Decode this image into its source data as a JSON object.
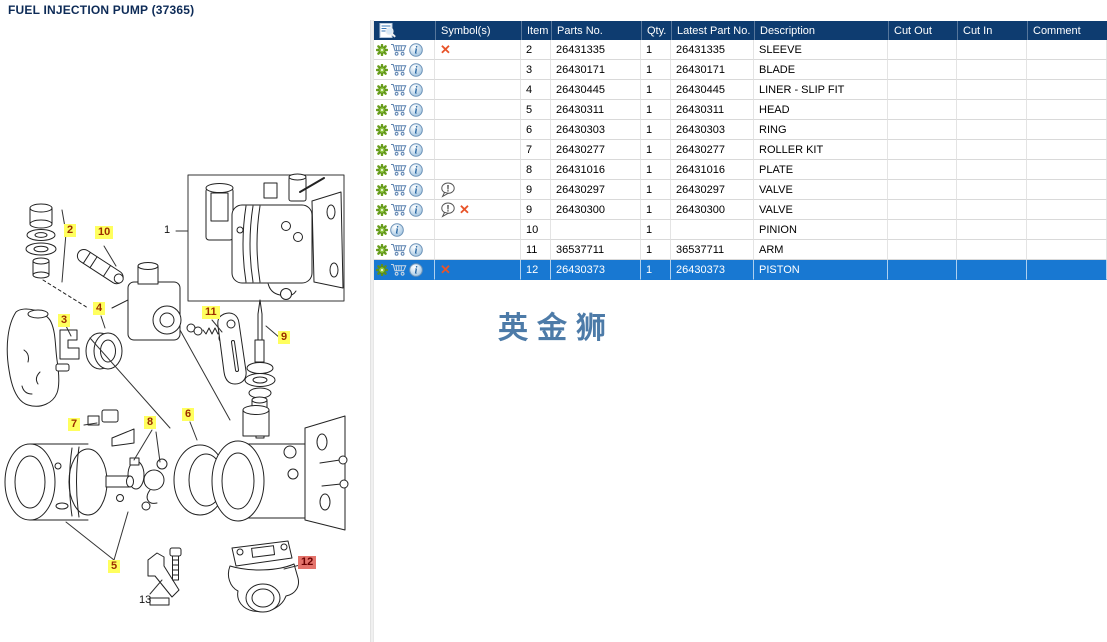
{
  "page": {
    "title": "FUEL INJECTION PUMP (37365)"
  },
  "watermark": {
    "text": "英金狮"
  },
  "toolbar": {
    "buttons": [
      {
        "name": "zoom-in-button",
        "icon": "plus-icon"
      },
      {
        "name": "zoom-out-button",
        "icon": "minus-icon"
      },
      {
        "name": "tile-view-button",
        "icon": "grid-icon"
      },
      {
        "name": "fit-view-button",
        "icon": "square-icon"
      },
      {
        "name": "toggle-panel-button",
        "icon": "panel-arrow-icon"
      }
    ]
  },
  "diagram": {
    "callouts": [
      {
        "label": "1",
        "style": "plain"
      },
      {
        "label": "2",
        "style": "yellow"
      },
      {
        "label": "3",
        "style": "yellow"
      },
      {
        "label": "4",
        "style": "yellow"
      },
      {
        "label": "5",
        "style": "yellow"
      },
      {
        "label": "6",
        "style": "yellow"
      },
      {
        "label": "7",
        "style": "yellow"
      },
      {
        "label": "8",
        "style": "yellow"
      },
      {
        "label": "9",
        "style": "yellow"
      },
      {
        "label": "10",
        "style": "yellow"
      },
      {
        "label": "11",
        "style": "yellow"
      },
      {
        "label": "12",
        "style": "red"
      },
      {
        "label": "13",
        "style": "plain"
      }
    ]
  },
  "table": {
    "columns": [
      "",
      "Symbol(s)",
      "Item",
      "Parts No.",
      "Qty.",
      "Latest Part No.",
      "Description",
      "Cut Out",
      "Cut In",
      "Comment"
    ],
    "rows": [
      {
        "symbols": [
          "x"
        ],
        "item": "2",
        "parts_no": "26431335",
        "qty": "1",
        "latest_part_no": "26431335",
        "description": "SLEEVE",
        "cut_out": "",
        "cut_in": "",
        "comment": "",
        "cart": true,
        "selected": false
      },
      {
        "symbols": [],
        "item": "3",
        "parts_no": "26430171",
        "qty": "1",
        "latest_part_no": "26430171",
        "description": "BLADE",
        "cut_out": "",
        "cut_in": "",
        "comment": "",
        "cart": true,
        "selected": false
      },
      {
        "symbols": [],
        "item": "4",
        "parts_no": "26430445",
        "qty": "1",
        "latest_part_no": "26430445",
        "description": "LINER - SLIP FIT",
        "cut_out": "",
        "cut_in": "",
        "comment": "",
        "cart": true,
        "selected": false
      },
      {
        "symbols": [],
        "item": "5",
        "parts_no": "26430311",
        "qty": "1",
        "latest_part_no": "26430311",
        "description": "HEAD",
        "cut_out": "",
        "cut_in": "",
        "comment": "",
        "cart": true,
        "selected": false
      },
      {
        "symbols": [],
        "item": "6",
        "parts_no": "26430303",
        "qty": "1",
        "latest_part_no": "26430303",
        "description": "RING",
        "cut_out": "",
        "cut_in": "",
        "comment": "",
        "cart": true,
        "selected": false
      },
      {
        "symbols": [],
        "item": "7",
        "parts_no": "26430277",
        "qty": "1",
        "latest_part_no": "26430277",
        "description": "ROLLER KIT",
        "cut_out": "",
        "cut_in": "",
        "comment": "",
        "cart": true,
        "selected": false
      },
      {
        "symbols": [],
        "item": "8",
        "parts_no": "26431016",
        "qty": "1",
        "latest_part_no": "26431016",
        "description": "PLATE",
        "cut_out": "",
        "cut_in": "",
        "comment": "",
        "cart": true,
        "selected": false
      },
      {
        "symbols": [
          "balloon"
        ],
        "item": "9",
        "parts_no": "26430297",
        "qty": "1",
        "latest_part_no": "26430297",
        "description": "VALVE",
        "cut_out": "",
        "cut_in": "",
        "comment": "",
        "cart": true,
        "selected": false
      },
      {
        "symbols": [
          "balloon",
          "x"
        ],
        "item": "9",
        "parts_no": "26430300",
        "qty": "1",
        "latest_part_no": "26430300",
        "description": "VALVE",
        "cut_out": "",
        "cut_in": "",
        "comment": "",
        "cart": true,
        "selected": false
      },
      {
        "symbols": [],
        "item": "10",
        "parts_no": "",
        "qty": "1",
        "latest_part_no": "",
        "description": "PINION",
        "cut_out": "",
        "cut_in": "",
        "comment": "",
        "cart": false,
        "selected": false
      },
      {
        "symbols": [],
        "item": "11",
        "parts_no": "36537711",
        "qty": "1",
        "latest_part_no": "36537711",
        "description": "ARM",
        "cut_out": "",
        "cut_in": "",
        "comment": "",
        "cart": true,
        "selected": false
      },
      {
        "symbols": [
          "x"
        ],
        "item": "12",
        "parts_no": "26430373",
        "qty": "1",
        "latest_part_no": "26430373",
        "description": "PISTON",
        "cut_out": "",
        "cut_in": "",
        "comment": "",
        "cart": true,
        "selected": true
      }
    ]
  },
  "colors": {
    "title_text": "#0d2b57",
    "header_bg": "#0e3c70",
    "selected_row_bg": "#1878d2",
    "callout_yellow": "#ffff5e",
    "callout_red_bg": "#e4736b",
    "symbol_x": "#e8542a",
    "gear_green": "#7db32a",
    "watermark": "#4d7ba8"
  }
}
